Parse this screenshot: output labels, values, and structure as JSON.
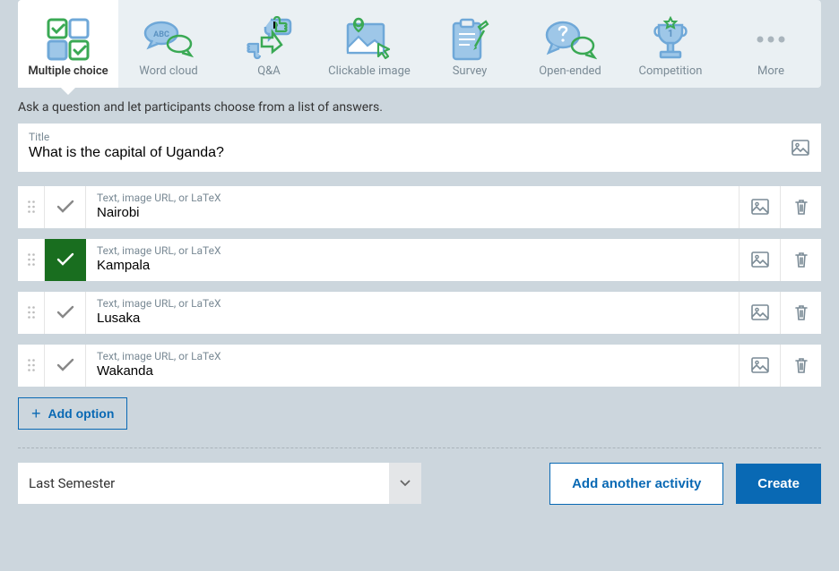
{
  "tabs": [
    {
      "label": "Multiple choice",
      "active": true
    },
    {
      "label": "Word cloud",
      "active": false
    },
    {
      "label": "Q&A",
      "active": false
    },
    {
      "label": "Clickable image",
      "active": false
    },
    {
      "label": "Survey",
      "active": false
    },
    {
      "label": "Open-ended",
      "active": false
    },
    {
      "label": "Competition",
      "active": false
    },
    {
      "label": "More",
      "active": false
    }
  ],
  "description": "Ask a question and let participants choose from a list of answers.",
  "title": {
    "label": "Title",
    "value": "What is the capital of Uganda?"
  },
  "option_placeholder": "Text, image URL, or LaTeX",
  "options": [
    {
      "text": "Nairobi",
      "correct": false
    },
    {
      "text": "Kampala",
      "correct": true
    },
    {
      "text": "Lusaka",
      "correct": false
    },
    {
      "text": "Wakanda",
      "correct": false
    }
  ],
  "add_option_label": "Add option",
  "folder": {
    "selected": "Last Semester"
  },
  "buttons": {
    "add_another": "Add another activity",
    "create": "Create"
  }
}
